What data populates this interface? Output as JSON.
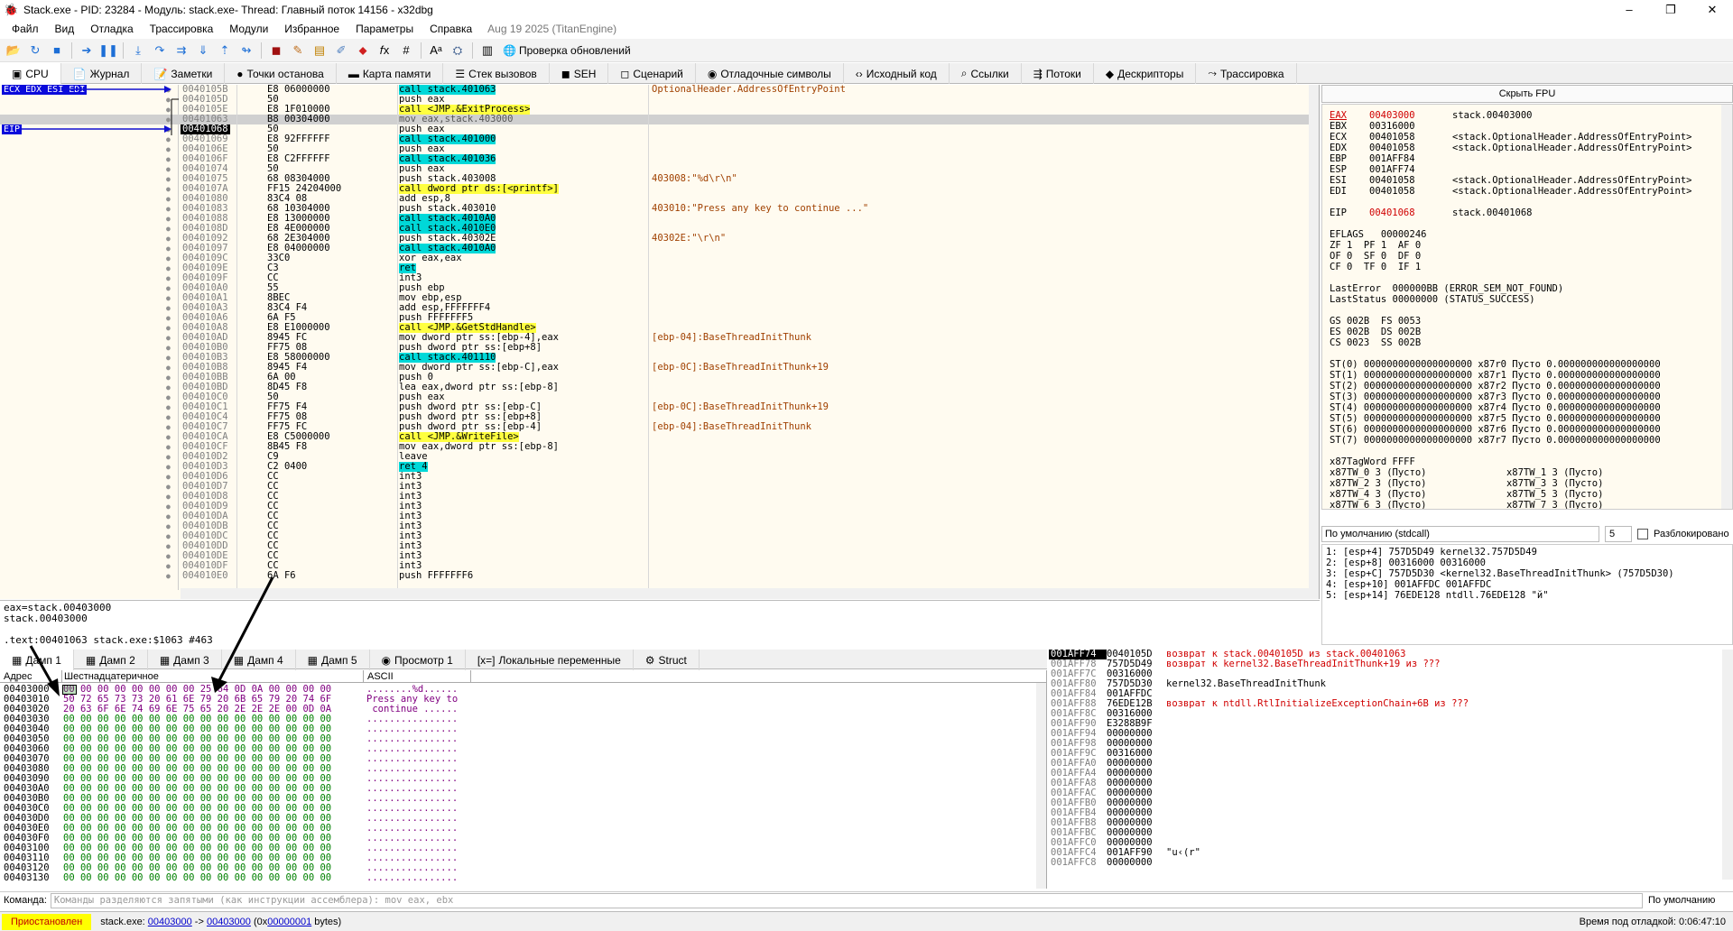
{
  "window": {
    "title": "Stack.exe - PID: 23284 - Модуль: stack.exe- Thread: Главный поток 14156 - x32dbg",
    "min": "–",
    "max": "❐",
    "close": "✕"
  },
  "menu": {
    "items": [
      "Файл",
      "Вид",
      "Отладка",
      "Трассировка",
      "Модули",
      "Избранное",
      "Параметры",
      "Справка"
    ],
    "engine": "Aug 19 2025 (TitanEngine)"
  },
  "toolbar": {
    "update_label": "Проверка обновлений"
  },
  "tabs": [
    {
      "icon": "▣",
      "label": "CPU"
    },
    {
      "icon": "📄",
      "label": "Журнал"
    },
    {
      "icon": "📝",
      "label": "Заметки"
    },
    {
      "icon": "●",
      "label": "Точки останова"
    },
    {
      "icon": "▬",
      "label": "Карта памяти"
    },
    {
      "icon": "☰",
      "label": "Стек вызовов"
    },
    {
      "icon": "◼",
      "label": "SEH"
    },
    {
      "icon": "◻",
      "label": "Сценарий"
    },
    {
      "icon": "◉",
      "label": "Отладочные символы"
    },
    {
      "icon": "‹›",
      "label": "Исходный код"
    },
    {
      "icon": "⌕",
      "label": "Ссылки"
    },
    {
      "icon": "⇶",
      "label": "Потоки"
    },
    {
      "icon": "◆",
      "label": "Дескрипторы"
    },
    {
      "icon": "⤳",
      "label": "Трассировка"
    }
  ],
  "disasm": {
    "reg_labels": {
      "top": "ECX EDX ESI EDI",
      "eip": "EIP"
    },
    "rows": [
      {
        "addr": "0040105B",
        "bytes": "E8 06000000",
        "instr": "call stack.401063",
        "cls": "call",
        "com": "OptionalHeader.AddressOfEntryPoint"
      },
      {
        "addr": "0040105D",
        "bytes": "50",
        "instr": "push eax",
        "cls": "",
        "com": ""
      },
      {
        "addr": "0040105E",
        "bytes": "E8 1F010000",
        "instr": "call <JMP.&ExitProcess>",
        "cls": "callj",
        "com": ""
      },
      {
        "addr": "00401063",
        "bytes": "B8 00304000",
        "instr": "mov eax,stack.403000",
        "cls": "gray",
        "com": ""
      },
      {
        "addr": "00401068",
        "bytes": "50",
        "instr": "push eax",
        "cls": "cur",
        "com": ""
      },
      {
        "addr": "00401069",
        "bytes": "E8 92FFFFFF",
        "instr": "call stack.401000",
        "cls": "call",
        "com": ""
      },
      {
        "addr": "0040106E",
        "bytes": "50",
        "instr": "push eax",
        "cls": "",
        "com": ""
      },
      {
        "addr": "0040106F",
        "bytes": "E8 C2FFFFFF",
        "instr": "call stack.401036",
        "cls": "call",
        "com": ""
      },
      {
        "addr": "00401074",
        "bytes": "50",
        "instr": "push eax",
        "cls": "",
        "com": ""
      },
      {
        "addr": "00401075",
        "bytes": "68 08304000",
        "instr": "push stack.403008",
        "cls": "",
        "com": "403008:\"%d\\r\\n\""
      },
      {
        "addr": "0040107A",
        "bytes": "FF15 24204000",
        "instr": "call dword ptr ds:[<printf>]",
        "cls": "callp",
        "com": ""
      },
      {
        "addr": "00401080",
        "bytes": "83C4 08",
        "instr": "add esp,8",
        "cls": "",
        "com": ""
      },
      {
        "addr": "00401083",
        "bytes": "68 10304000",
        "instr": "push stack.403010",
        "cls": "",
        "com": "403010:\"Press any key to continue ...\""
      },
      {
        "addr": "00401088",
        "bytes": "E8 13000000",
        "instr": "call stack.4010A0",
        "cls": "call",
        "com": ""
      },
      {
        "addr": "0040108D",
        "bytes": "E8 4E000000",
        "instr": "call stack.4010E0",
        "cls": "call",
        "com": ""
      },
      {
        "addr": "00401092",
        "bytes": "68 2E304000",
        "instr": "push stack.40302E",
        "cls": "",
        "com": "40302E:\"\\r\\n\""
      },
      {
        "addr": "00401097",
        "bytes": "E8 04000000",
        "instr": "call stack.4010A0",
        "cls": "call",
        "com": ""
      },
      {
        "addr": "0040109C",
        "bytes": "33C0",
        "instr": "xor eax,eax",
        "cls": "",
        "com": ""
      },
      {
        "addr": "0040109E",
        "bytes": "C3",
        "instr": "ret",
        "cls": "ret",
        "com": ""
      },
      {
        "addr": "0040109F",
        "bytes": "CC",
        "instr": "int3",
        "cls": "",
        "com": ""
      },
      {
        "addr": "004010A0",
        "bytes": "55",
        "instr": "push ebp",
        "cls": "",
        "com": ""
      },
      {
        "addr": "004010A1",
        "bytes": "8BEC",
        "instr": "mov ebp,esp",
        "cls": "",
        "com": ""
      },
      {
        "addr": "004010A3",
        "bytes": "83C4 F4",
        "instr": "add esp,FFFFFFF4",
        "cls": "",
        "com": ""
      },
      {
        "addr": "004010A6",
        "bytes": "6A F5",
        "instr": "push FFFFFFF5",
        "cls": "",
        "com": ""
      },
      {
        "addr": "004010A8",
        "bytes": "E8 E1000000",
        "instr": "call <JMP.&GetStdHandle>",
        "cls": "callj",
        "com": ""
      },
      {
        "addr": "004010AD",
        "bytes": "8945 FC",
        "instr": "mov dword ptr ss:[ebp-4],eax",
        "cls": "",
        "com": "[ebp-04]:BaseThreadInitThunk"
      },
      {
        "addr": "004010B0",
        "bytes": "FF75 08",
        "instr": "push dword ptr ss:[ebp+8]",
        "cls": "",
        "com": ""
      },
      {
        "addr": "004010B3",
        "bytes": "E8 58000000",
        "instr": "call stack.401110",
        "cls": "call",
        "com": ""
      },
      {
        "addr": "004010B8",
        "bytes": "8945 F4",
        "instr": "mov dword ptr ss:[ebp-C],eax",
        "cls": "",
        "com": "[ebp-0C]:BaseThreadInitThunk+19"
      },
      {
        "addr": "004010BB",
        "bytes": "6A 00",
        "instr": "push 0",
        "cls": "",
        "com": ""
      },
      {
        "addr": "004010BD",
        "bytes": "8D45 F8",
        "instr": "lea eax,dword ptr ss:[ebp-8]",
        "cls": "",
        "com": ""
      },
      {
        "addr": "004010C0",
        "bytes": "50",
        "instr": "push eax",
        "cls": "",
        "com": ""
      },
      {
        "addr": "004010C1",
        "bytes": "FF75 F4",
        "instr": "push dword ptr ss:[ebp-C]",
        "cls": "",
        "com": "[ebp-0C]:BaseThreadInitThunk+19"
      },
      {
        "addr": "004010C4",
        "bytes": "FF75 08",
        "instr": "push dword ptr ss:[ebp+8]",
        "cls": "",
        "com": ""
      },
      {
        "addr": "004010C7",
        "bytes": "FF75 FC",
        "instr": "push dword ptr ss:[ebp-4]",
        "cls": "",
        "com": "[ebp-04]:BaseThreadInitThunk"
      },
      {
        "addr": "004010CA",
        "bytes": "E8 C5000000",
        "instr": "call <JMP.&WriteFile>",
        "cls": "callj",
        "com": ""
      },
      {
        "addr": "004010CF",
        "bytes": "8B45 F8",
        "instr": "mov eax,dword ptr ss:[ebp-8]",
        "cls": "",
        "com": ""
      },
      {
        "addr": "004010D2",
        "bytes": "C9",
        "instr": "leave",
        "cls": "",
        "com": ""
      },
      {
        "addr": "004010D3",
        "bytes": "C2 0400",
        "instr": "ret 4",
        "cls": "ret",
        "com": ""
      },
      {
        "addr": "004010D6",
        "bytes": "CC",
        "instr": "int3",
        "cls": "",
        "com": ""
      },
      {
        "addr": "004010D7",
        "bytes": "CC",
        "instr": "int3",
        "cls": "",
        "com": ""
      },
      {
        "addr": "004010D8",
        "bytes": "CC",
        "instr": "int3",
        "cls": "",
        "com": ""
      },
      {
        "addr": "004010D9",
        "bytes": "CC",
        "instr": "int3",
        "cls": "",
        "com": ""
      },
      {
        "addr": "004010DA",
        "bytes": "CC",
        "instr": "int3",
        "cls": "",
        "com": ""
      },
      {
        "addr": "004010DB",
        "bytes": "CC",
        "instr": "int3",
        "cls": "",
        "com": ""
      },
      {
        "addr": "004010DC",
        "bytes": "CC",
        "instr": "int3",
        "cls": "",
        "com": ""
      },
      {
        "addr": "004010DD",
        "bytes": "CC",
        "instr": "int3",
        "cls": "",
        "com": ""
      },
      {
        "addr": "004010DE",
        "bytes": "CC",
        "instr": "int3",
        "cls": "",
        "com": ""
      },
      {
        "addr": "004010DF",
        "bytes": "CC",
        "instr": "int3",
        "cls": "",
        "com": ""
      },
      {
        "addr": "004010E0",
        "bytes": "6A F6",
        "instr": "push FFFFFFF6",
        "cls": "",
        "com": ""
      }
    ]
  },
  "info": {
    "line1": "eax=stack.00403000",
    "line2": "stack.00403000",
    "line3": ".text:00401063 stack.exe:$1063 #463"
  },
  "registers": {
    "hide_fpu": "Скрыть FPU",
    "gp": [
      {
        "n": "EAX",
        "v": "00403000",
        "c": "stack.00403000",
        "red": true
      },
      {
        "n": "EBX",
        "v": "00316000",
        "c": "",
        "red": false
      },
      {
        "n": "ECX",
        "v": "00401058",
        "c": "<stack.OptionalHeader.AddressOfEntryPoint>",
        "red": false
      },
      {
        "n": "EDX",
        "v": "00401058",
        "c": "<stack.OptionalHeader.AddressOfEntryPoint>",
        "red": false
      },
      {
        "n": "EBP",
        "v": "001AFF84",
        "c": "",
        "red": false
      },
      {
        "n": "ESP",
        "v": "001AFF74",
        "c": "",
        "red": false
      },
      {
        "n": "ESI",
        "v": "00401058",
        "c": "<stack.OptionalHeader.AddressOfEntryPoint>",
        "red": false
      },
      {
        "n": "EDI",
        "v": "00401058",
        "c": "<stack.OptionalHeader.AddressOfEntryPoint>",
        "red": false
      }
    ],
    "eip": {
      "n": "EIP",
      "v": "00401068",
      "c": "stack.00401068"
    },
    "lines": [
      "EFLAGS   00000246",
      "ZF 1  PF 1  AF 0",
      "OF 0  SF 0  DF 0",
      "CF 0  TF 0  IF 1",
      "",
      "LastError  000000BB (ERROR_SEM_NOT_FOUND)",
      "LastStatus 00000000 (STATUS_SUCCESS)",
      "",
      "GS 002B  FS 0053",
      "ES 002B  DS 002B",
      "CS 0023  SS 002B",
      "",
      "ST(0) 0000000000000000000 x87r0 Пусто 0.000000000000000000",
      "ST(1) 0000000000000000000 x87r1 Пусто 0.000000000000000000",
      "ST(2) 0000000000000000000 x87r2 Пусто 0.000000000000000000",
      "ST(3) 0000000000000000000 x87r3 Пусто 0.000000000000000000",
      "ST(4) 0000000000000000000 x87r4 Пусто 0.000000000000000000",
      "ST(5) 0000000000000000000 x87r5 Пусто 0.000000000000000000",
      "ST(6) 0000000000000000000 x87r6 Пусто 0.000000000000000000",
      "ST(7) 0000000000000000000 x87r7 Пусто 0.000000000000000000",
      "",
      "x87TagWord FFFF",
      "x87TW_0 3 (Пусто)              x87TW_1 3 (Пусто)",
      "x87TW_2 3 (Пусто)              x87TW_3 3 (Пусто)",
      "x87TW_4 3 (Пусто)              x87TW_5 3 (Пусто)",
      "x87TW_6 3 (Пусто)              x87TW_7 3 (Пусто)"
    ]
  },
  "callconv": {
    "select": "По умолчанию (stdcall)",
    "count": "5",
    "unlock": "Разблокировано"
  },
  "stackargs": [
    "1: [esp+4] 757D5D49 kernel32.757D5D49",
    "2: [esp+8] 00316000 00316000",
    "3: [esp+C] 757D5D30 <kernel32.BaseThreadInitThunk> (757D5D30)",
    "4: [esp+10] 001AFFDC 001AFFDC",
    "5: [esp+14] 76EDE128 ntdll.76EDE128 \"й\""
  ],
  "dumptabs": [
    {
      "icon": "▦",
      "label": "Дамп 1"
    },
    {
      "icon": "▦",
      "label": "Дамп 2"
    },
    {
      "icon": "▦",
      "label": "Дамп 3"
    },
    {
      "icon": "▦",
      "label": "Дамп 4"
    },
    {
      "icon": "▦",
      "label": "Дамп 5"
    },
    {
      "icon": "◉",
      "label": "Просмотр 1"
    },
    {
      "icon": "[x=]",
      "label": "Локальные переменные"
    },
    {
      "icon": "⚙",
      "label": "Struct"
    }
  ],
  "dump": {
    "headers": {
      "addr": "Адрес",
      "hex": "Шестнадцатеричное",
      "ascii": "ASCII"
    },
    "rows": [
      {
        "a": "00403000",
        "h": "00 00 00 00 00 00 00 00 25 64 0D 0A 00 00 00 00",
        "s": "........%d......"
      },
      {
        "a": "00403010",
        "h": "50 72 65 73 73 20 61 6E 79 20 6B 65 79 20 74 6F",
        "s": "Press any key to"
      },
      {
        "a": "00403020",
        "h": "20 63 6F 6E 74 69 6E 75 65 20 2E 2E 2E 00 0D 0A",
        "s": " continue ......"
      },
      {
        "a": "00403030",
        "h": "00 00 00 00 00 00 00 00 00 00 00 00 00 00 00 00",
        "s": "................"
      },
      {
        "a": "00403040",
        "h": "00 00 00 00 00 00 00 00 00 00 00 00 00 00 00 00",
        "s": "................"
      },
      {
        "a": "00403050",
        "h": "00 00 00 00 00 00 00 00 00 00 00 00 00 00 00 00",
        "s": "................"
      },
      {
        "a": "00403060",
        "h": "00 00 00 00 00 00 00 00 00 00 00 00 00 00 00 00",
        "s": "................"
      },
      {
        "a": "00403070",
        "h": "00 00 00 00 00 00 00 00 00 00 00 00 00 00 00 00",
        "s": "................"
      },
      {
        "a": "00403080",
        "h": "00 00 00 00 00 00 00 00 00 00 00 00 00 00 00 00",
        "s": "................"
      },
      {
        "a": "00403090",
        "h": "00 00 00 00 00 00 00 00 00 00 00 00 00 00 00 00",
        "s": "................"
      },
      {
        "a": "004030A0",
        "h": "00 00 00 00 00 00 00 00 00 00 00 00 00 00 00 00",
        "s": "................"
      },
      {
        "a": "004030B0",
        "h": "00 00 00 00 00 00 00 00 00 00 00 00 00 00 00 00",
        "s": "................"
      },
      {
        "a": "004030C0",
        "h": "00 00 00 00 00 00 00 00 00 00 00 00 00 00 00 00",
        "s": "................"
      },
      {
        "a": "004030D0",
        "h": "00 00 00 00 00 00 00 00 00 00 00 00 00 00 00 00",
        "s": "................"
      },
      {
        "a": "004030E0",
        "h": "00 00 00 00 00 00 00 00 00 00 00 00 00 00 00 00",
        "s": "................"
      },
      {
        "a": "004030F0",
        "h": "00 00 00 00 00 00 00 00 00 00 00 00 00 00 00 00",
        "s": "................"
      },
      {
        "a": "00403100",
        "h": "00 00 00 00 00 00 00 00 00 00 00 00 00 00 00 00",
        "s": "................"
      },
      {
        "a": "00403110",
        "h": "00 00 00 00 00 00 00 00 00 00 00 00 00 00 00 00",
        "s": "................"
      },
      {
        "a": "00403120",
        "h": "00 00 00 00 00 00 00 00 00 00 00 00 00 00 00 00",
        "s": "................"
      },
      {
        "a": "00403130",
        "h": "00 00 00 00 00 00 00 00 00 00 00 00 00 00 00 00",
        "s": "................"
      }
    ]
  },
  "stack": [
    {
      "a": "001AFF74",
      "v": "0040105D",
      "c": "возврат к stack.0040105D из stack.00401063",
      "cur": true,
      "red": true
    },
    {
      "a": "001AFF78",
      "v": "757D5D49",
      "c": "возврат к kernel32.BaseThreadInitThunk+19 из ???",
      "cur": false,
      "red": true
    },
    {
      "a": "001AFF7C",
      "v": "00316000",
      "c": "",
      "cur": false,
      "red": false
    },
    {
      "a": "001AFF80",
      "v": "757D5D30",
      "c": "kernel32.BaseThreadInitThunk",
      "cur": false,
      "red": false
    },
    {
      "a": "001AFF84",
      "v": "001AFFDC",
      "c": "",
      "cur": false,
      "red": false
    },
    {
      "a": "001AFF88",
      "v": "76EDE12B",
      "c": "возврат к ntdll.RtlInitializeExceptionChain+6B из ???",
      "cur": false,
      "red": true
    },
    {
      "a": "001AFF8C",
      "v": "00316000",
      "c": "",
      "cur": false,
      "red": false
    },
    {
      "a": "001AFF90",
      "v": "E3288B9F",
      "c": "",
      "cur": false,
      "red": false
    },
    {
      "a": "001AFF94",
      "v": "00000000",
      "c": "",
      "cur": false,
      "red": false
    },
    {
      "a": "001AFF98",
      "v": "00000000",
      "c": "",
      "cur": false,
      "red": false
    },
    {
      "a": "001AFF9C",
      "v": "00316000",
      "c": "",
      "cur": false,
      "red": false
    },
    {
      "a": "001AFFA0",
      "v": "00000000",
      "c": "",
      "cur": false,
      "red": false
    },
    {
      "a": "001AFFA4",
      "v": "00000000",
      "c": "",
      "cur": false,
      "red": false
    },
    {
      "a": "001AFFA8",
      "v": "00000000",
      "c": "",
      "cur": false,
      "red": false
    },
    {
      "a": "001AFFAC",
      "v": "00000000",
      "c": "",
      "cur": false,
      "red": false
    },
    {
      "a": "001AFFB0",
      "v": "00000000",
      "c": "",
      "cur": false,
      "red": false
    },
    {
      "a": "001AFFB4",
      "v": "00000000",
      "c": "",
      "cur": false,
      "red": false
    },
    {
      "a": "001AFFB8",
      "v": "00000000",
      "c": "",
      "cur": false,
      "red": false
    },
    {
      "a": "001AFFBC",
      "v": "00000000",
      "c": "",
      "cur": false,
      "red": false
    },
    {
      "a": "001AFFC0",
      "v": "00000000",
      "c": "",
      "cur": false,
      "red": false
    },
    {
      "a": "001AFFC4",
      "v": "001AFF90",
      "c": "\"u‹(r\"",
      "cur": false,
      "red": false
    },
    {
      "a": "001AFFC8",
      "v": "00000000",
      "c": "",
      "cur": false,
      "red": false
    }
  ],
  "command": {
    "label": "Команда:",
    "placeholder": "Команды разделяются запятыми (как инструкции ассемблера): mov eax, ebx",
    "default": "По умолчанию"
  },
  "status": {
    "state": "Приостановлен",
    "pre": "stack.exe: ",
    "from": "00403000",
    "mid": " -> ",
    "to": "00403000",
    "size_pre": " (0x",
    "size": "00000001",
    "size_post": " bytes)",
    "time": "Время под отладкой: 0:06:47:10"
  }
}
